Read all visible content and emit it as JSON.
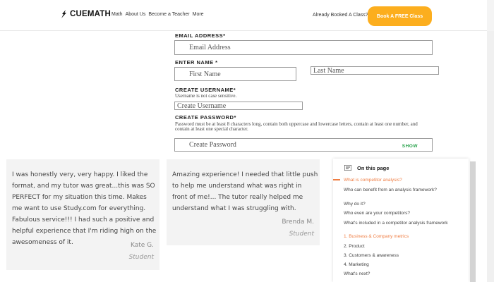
{
  "header": {
    "logo_text": "CUEMATH",
    "nav": [
      "Math",
      "About Us",
      "Become a Teacher",
      "More"
    ],
    "already_booked": "Already Booked A Class?",
    "cta_label": "Book A FREE Class"
  },
  "form": {
    "email_label": "EMAIL ADDRESS*",
    "email_placeholder": "Email Address",
    "name_label": "ENTER NAME *",
    "first_name_placeholder": "First Name",
    "last_name_placeholder": "Last Name",
    "username_label": "CREATE USERNAME*",
    "username_hint": "Username is not case sensitive.",
    "username_placeholder": "Create Username",
    "password_label": "CREATE PASSWORD*",
    "password_hint": "Password must be at least 8 characters long, contain both uppercase and lowercase letters, contain at least one number, and contain at least one special character.",
    "password_placeholder": "Create Password",
    "show_label": "SHOW"
  },
  "testimonials": [
    {
      "quote": "I was honestly very, very happy. I liked the format, and my tutor was great...this was SO PERFECT for my situation this time. Makes me want to use Study.com for everything. Fabulous service!!! I had such a positive and helpful experience that I'm riding high on the awesomeness of it.",
      "author": "Kate G.",
      "role": "Student"
    },
    {
      "quote": "Amazing experience! I needed that little push to help me understand what was right in front of me!... The tutor really helped me understand what I was struggling with.",
      "author": "Brenda M.",
      "role": "Student"
    }
  ],
  "toc": {
    "title": "On this page",
    "items": [
      "What is competitor analysis?",
      "Who can benefit from an analysis framework?",
      "Why do it?",
      "Who even are your competitors?",
      "What's included in a competitor analysis framework",
      "1. Business & Company metrics",
      "2. Product",
      "3. Customers & awareness",
      "4. Marketing",
      "What's next?"
    ],
    "accent": "#ef7d43"
  },
  "colors": {
    "cta": "#fcae1e",
    "show": "#27a14a"
  }
}
